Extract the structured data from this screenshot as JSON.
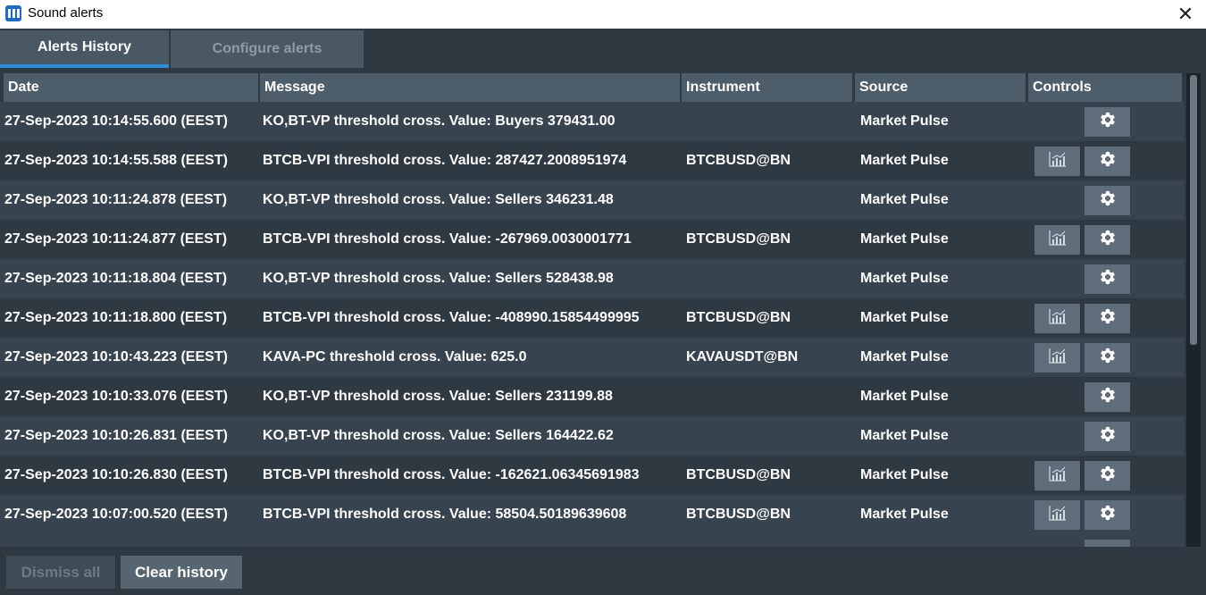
{
  "window": {
    "title": "Sound alerts",
    "close_label": "✕"
  },
  "tabs": [
    {
      "label": "Alerts History",
      "active": true
    },
    {
      "label": "Configure alerts",
      "active": false
    }
  ],
  "columns": [
    "Date",
    "Message",
    "Instrument",
    "Source",
    "Controls"
  ],
  "rows": [
    {
      "date": "27-Sep-2023 10:14:55.600 (EEST)",
      "message": "KO,BT-VP threshold cross. Value: Buyers 379431.00",
      "instrument": "",
      "source": "Market Pulse",
      "has_chart": false
    },
    {
      "date": "27-Sep-2023 10:14:55.588 (EEST)",
      "message": "BTCB-VPI threshold cross. Value:  287427.2008951974",
      "instrument": "BTCBUSD@BN",
      "source": "Market Pulse",
      "has_chart": true
    },
    {
      "date": "27-Sep-2023 10:11:24.878 (EEST)",
      "message": "KO,BT-VP threshold cross. Value: Sellers 346231.48",
      "instrument": "",
      "source": "Market Pulse",
      "has_chart": false
    },
    {
      "date": "27-Sep-2023 10:11:24.877 (EEST)",
      "message": "BTCB-VPI threshold cross. Value:  -267969.0030001771",
      "instrument": "BTCBUSD@BN",
      "source": "Market Pulse",
      "has_chart": true
    },
    {
      "date": "27-Sep-2023 10:11:18.804 (EEST)",
      "message": "KO,BT-VP threshold cross. Value: Sellers 528438.98",
      "instrument": "",
      "source": "Market Pulse",
      "has_chart": false
    },
    {
      "date": "27-Sep-2023 10:11:18.800 (EEST)",
      "message": "BTCB-VPI threshold cross. Value:  -408990.15854499995",
      "instrument": "BTCBUSD@BN",
      "source": "Market Pulse",
      "has_chart": true
    },
    {
      "date": "27-Sep-2023 10:10:43.223 (EEST)",
      "message": "KAVA-PC threshold cross. Value:  625.0",
      "instrument": "KAVAUSDT@BN",
      "source": "Market Pulse",
      "has_chart": true
    },
    {
      "date": "27-Sep-2023 10:10:33.076 (EEST)",
      "message": "KO,BT-VP threshold cross. Value: Sellers 231199.88",
      "instrument": "",
      "source": "Market Pulse",
      "has_chart": false
    },
    {
      "date": "27-Sep-2023 10:10:26.831 (EEST)",
      "message": "KO,BT-VP threshold cross. Value: Sellers 164422.62",
      "instrument": "",
      "source": "Market Pulse",
      "has_chart": false
    },
    {
      "date": "27-Sep-2023 10:10:26.830 (EEST)",
      "message": "BTCB-VPI threshold cross. Value:  -162621.06345691983",
      "instrument": "BTCBUSD@BN",
      "source": "Market Pulse",
      "has_chart": true
    },
    {
      "date": "27-Sep-2023 10:07:00.520 (EEST)",
      "message": "BTCB-VPI threshold cross. Value:  58504.50189639608",
      "instrument": "BTCBUSD@BN",
      "source": "Market Pulse",
      "has_chart": true
    }
  ],
  "footer": {
    "dismiss_label": "Dismiss all",
    "clear_label": "Clear history"
  },
  "icons": {
    "chart": "chart-icon",
    "settings": "gear-icon",
    "app": "app-icon"
  },
  "colors": {
    "accent": "#2a8fd8",
    "background": "#2e3942",
    "header": "#4d5d6a"
  }
}
